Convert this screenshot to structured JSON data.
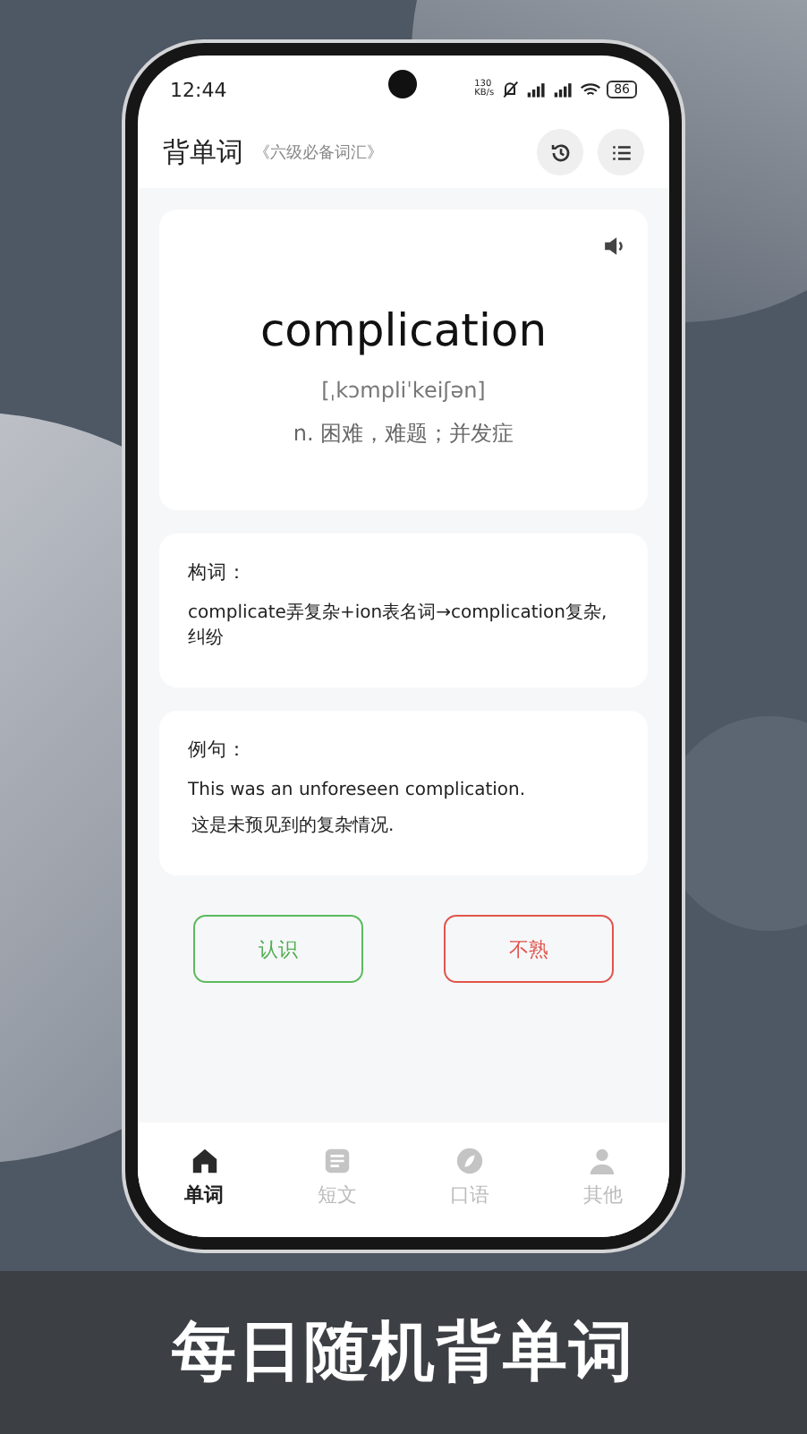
{
  "status_bar": {
    "time": "12:44",
    "net_speed": [
      "130",
      "KB/s"
    ],
    "battery": "86"
  },
  "header": {
    "title": "背单词",
    "subtitle": "《六级必备词汇》"
  },
  "word_card": {
    "word": "complication",
    "phonetic": "[ˌkɔmpliˈkeiʃən]",
    "meaning": "n. 困难，难题；并发症"
  },
  "sections": [
    {
      "label": "构词：",
      "lines": [
        "complicate弄复杂+ion表名词→complication复杂,纠纷"
      ]
    },
    {
      "label": "例句：",
      "lines": [
        "This was an unforeseen complication.",
        "这是未预见到的复杂情况."
      ]
    }
  ],
  "actions": [
    {
      "label": "认识",
      "kind": "known"
    },
    {
      "label": "不熟",
      "kind": "unfamiliar"
    }
  ],
  "tabs": [
    {
      "label": "单词",
      "kind": "home",
      "selected": true
    },
    {
      "label": "短文",
      "kind": "article",
      "selected": false
    },
    {
      "label": "口语",
      "kind": "compass",
      "selected": false
    },
    {
      "label": "其他",
      "kind": "person",
      "selected": false
    }
  ],
  "banner": {
    "text": "每日随机背单词"
  }
}
